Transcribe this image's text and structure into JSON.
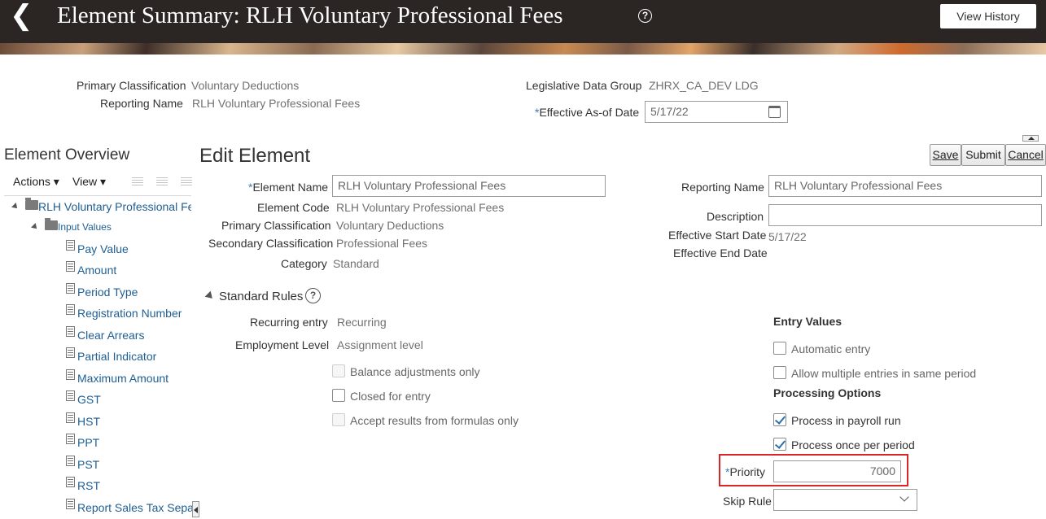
{
  "header": {
    "title": "Element Summary: RLH Voluntary Professional Fees",
    "view_history": "View History"
  },
  "summary": {
    "primary_classification_label": "Primary Classification",
    "primary_classification_value": "Voluntary Deductions",
    "reporting_name_label": "Reporting Name",
    "reporting_name_value": "RLH Voluntary Professional Fees",
    "ldg_label": "Legislative Data Group",
    "ldg_value": "ZHRX_CA_DEV LDG",
    "effective_date_label": "Effective As-of Date",
    "effective_date_value": "5/17/22"
  },
  "overview": {
    "title": "Element Overview",
    "actions": "Actions",
    "view": "View",
    "root": "RLH Voluntary Professional Fee",
    "input_values": "Input Values",
    "items": [
      "Pay Value",
      "Amount",
      "Period Type",
      "Registration Number",
      "Clear Arrears",
      "Partial Indicator",
      "Maximum Amount",
      "GST",
      "HST",
      "PPT",
      "PST",
      "RST",
      "Report Sales Tax Separa"
    ]
  },
  "edit": {
    "title": "Edit Element",
    "save": "Save",
    "submit": "Submit",
    "cancel": "Cancel",
    "element_name_label": "Element Name",
    "element_name_value": "RLH Voluntary Professional Fees",
    "element_code_label": "Element Code",
    "element_code_value": "RLH Voluntary Professional Fees",
    "primary_classification_label": "Primary Classification",
    "primary_classification_value": "Voluntary Deductions",
    "secondary_classification_label": "Secondary Classification",
    "secondary_classification_value": "Professional Fees",
    "category_label": "Category",
    "category_value": "Standard",
    "reporting_name_label": "Reporting Name",
    "reporting_name_value": "RLH Voluntary Professional Fees",
    "description_label": "Description",
    "description_value": "",
    "start_date_label": "Effective Start Date",
    "start_date_value": "5/17/22",
    "end_date_label": "Effective End Date"
  },
  "rules": {
    "title": "Standard Rules",
    "recurring_label": "Recurring entry",
    "recurring_value": "Recurring",
    "employment_label": "Employment Level",
    "employment_value": "Assignment level",
    "balance_adj": "Balance adjustments only",
    "closed_entry": "Closed for entry",
    "accept_results": "Accept results from formulas only",
    "entry_values_title": "Entry Values",
    "automatic_entry": "Automatic entry",
    "allow_multiple": "Allow multiple entries in same period",
    "processing_title": "Processing Options",
    "process_payroll": "Process in payroll run",
    "process_once": "Process once per period",
    "priority_label": "Priority",
    "priority_value": "7000",
    "skip_rule_label": "Skip Rule",
    "skip_rule_value": ""
  },
  "colors": {
    "header_bg": "#2b2624",
    "link": "#1e5e92",
    "highlight": "#d9262b",
    "check": "#2a6fae"
  }
}
